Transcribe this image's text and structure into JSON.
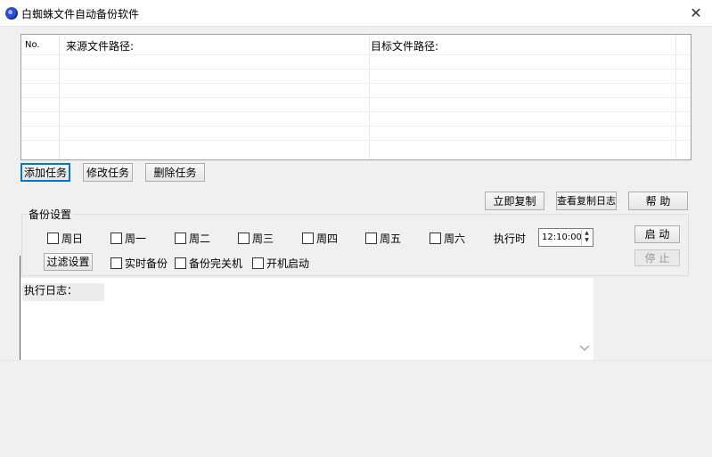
{
  "window": {
    "title": "白蜘蛛文件自动备份软件",
    "close_glyph": "✕"
  },
  "table": {
    "headers": {
      "no": "No.",
      "source": "来源文件路径:",
      "target": "目标文件路径:"
    }
  },
  "task_buttons": {
    "add": "添加任务",
    "edit": "修改任务",
    "delete": "删除任务"
  },
  "action_buttons": {
    "copy_now": "立即复制",
    "view_log": "查看复制日志",
    "help": "帮 助"
  },
  "backup_settings": {
    "group_label": "备份设置",
    "weekdays": [
      "周日",
      "周一",
      "周二",
      "周三",
      "周四",
      "周五",
      "周六"
    ],
    "exec_time_label": "执行时",
    "exec_time_value": "12:10:00",
    "filter_button": "过滤设置",
    "options": [
      "实时备份",
      "备份完关机",
      "开机启动"
    ],
    "start_button": "启 动",
    "stop_button": "停 止"
  },
  "log": {
    "label": "执行日志："
  }
}
